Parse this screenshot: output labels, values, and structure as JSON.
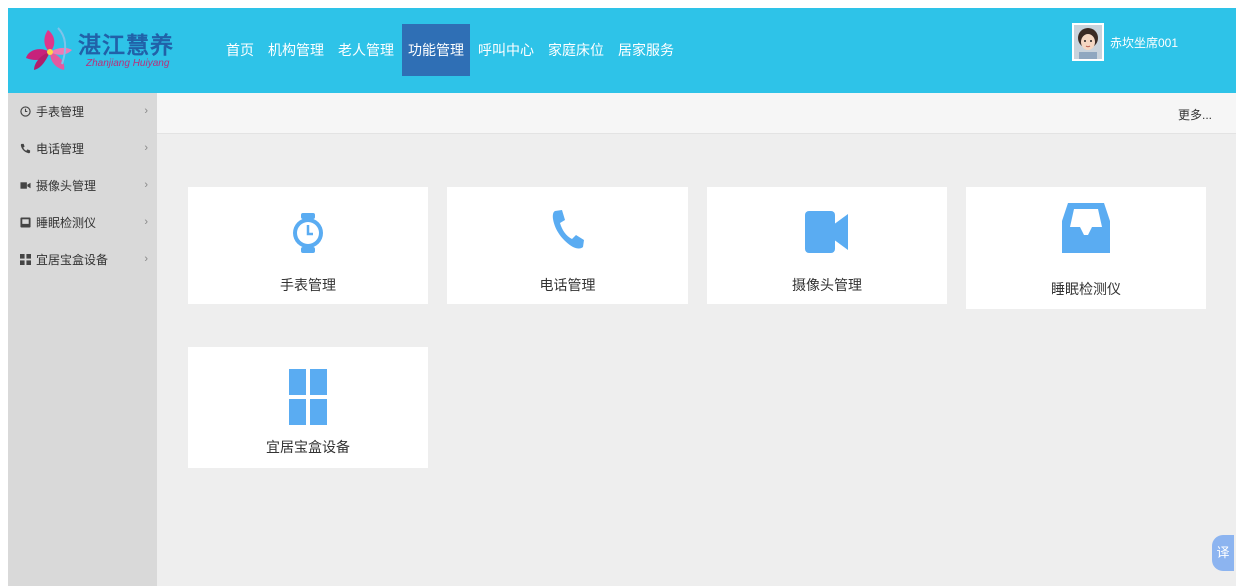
{
  "brand": {
    "name": "湛江慧养",
    "subtitle": "Zhanjiang Huiyang"
  },
  "nav": {
    "items": [
      {
        "label": "首页"
      },
      {
        "label": "机构管理"
      },
      {
        "label": "老人管理"
      },
      {
        "label": "功能管理",
        "active": true
      },
      {
        "label": "呼叫中心"
      },
      {
        "label": "家庭床位"
      },
      {
        "label": "居家服务"
      }
    ]
  },
  "user": {
    "name": "赤坎坐席001"
  },
  "sidebar": {
    "items": [
      {
        "label": "手表管理",
        "icon": "clock-icon"
      },
      {
        "label": "电话管理",
        "icon": "phone-icon"
      },
      {
        "label": "摄像头管理",
        "icon": "camera-icon"
      },
      {
        "label": "睡眠检测仪",
        "icon": "sleep-monitor-icon"
      },
      {
        "label": "宜居宝盒设备",
        "icon": "grid-icon"
      }
    ],
    "chevron": "›"
  },
  "subbar": {
    "more_label": "更多..."
  },
  "cards": [
    {
      "label": "手表管理",
      "icon": "clock-icon"
    },
    {
      "label": "电话管理",
      "icon": "phone-icon"
    },
    {
      "label": "摄像头管理",
      "icon": "camera-icon"
    },
    {
      "label": "睡眠检测仪",
      "icon": "sleep-monitor-icon"
    },
    {
      "label": "宜居宝盒设备",
      "icon": "grid-icon"
    }
  ],
  "translate": {
    "label": "译"
  },
  "colors": {
    "header": "#2ec3e8",
    "nav_active": "#2f6fb5",
    "icon_blue": "#5aacf2",
    "sidebar": "#d9d9d9",
    "content_bg": "#eeeeee"
  }
}
